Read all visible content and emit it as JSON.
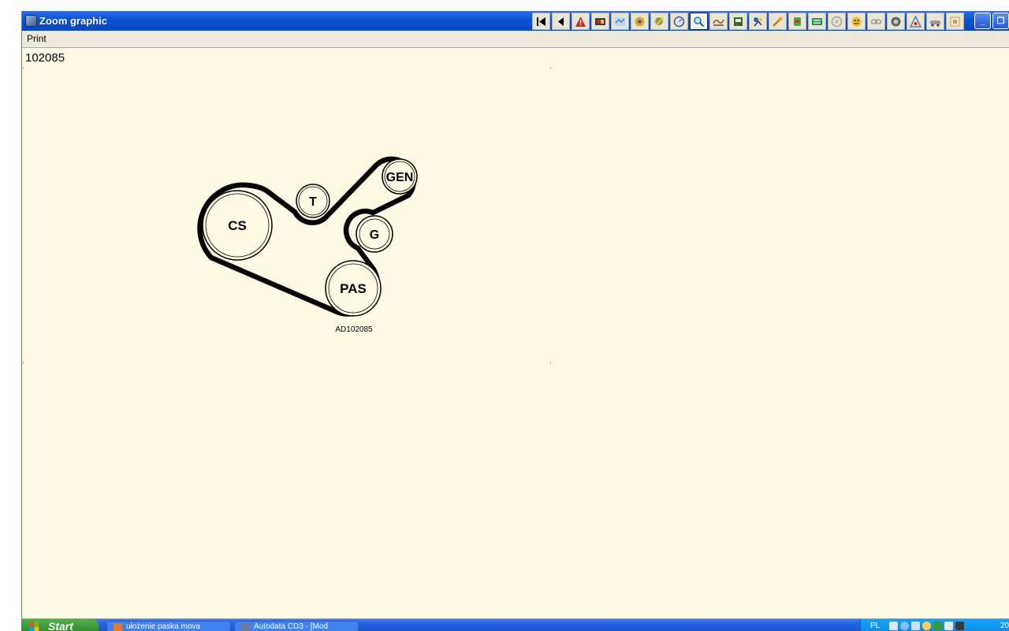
{
  "window": {
    "title": "Zoom graphic"
  },
  "toolbar": {
    "buttons": [
      {
        "name": "first-page-icon",
        "glyph": "|◀",
        "color": "#000000"
      },
      {
        "name": "previous-icon",
        "glyph": "◀",
        "color": "#000000"
      },
      {
        "name": "warning-icon",
        "glyph": "⚠",
        "color": "#d42a1a"
      },
      {
        "name": "engine-data-icon",
        "glyph": "■",
        "color": "#8a1a1a"
      },
      {
        "name": "adjustment-icon",
        "glyph": "≈",
        "color": "#3a7bd0"
      },
      {
        "name": "service-icon",
        "glyph": "⚙",
        "color": "#d08a1a"
      },
      {
        "name": "wrench-icon",
        "glyph": "✱",
        "color": "#6b8e23"
      },
      {
        "name": "gauge-icon",
        "glyph": "◎",
        "color": "#3a5a9a"
      },
      {
        "name": "zoom-graphic-icon",
        "glyph": "⌕",
        "color": "#1a7a9a"
      },
      {
        "name": "belt-icon",
        "glyph": "∿",
        "color": "#b06a1a"
      },
      {
        "name": "lift-icon",
        "glyph": "▥",
        "color": "#2a6a2a"
      },
      {
        "name": "repair-icon",
        "glyph": "✚",
        "color": "#1a5a9a"
      },
      {
        "name": "key-icon",
        "glyph": "⚷",
        "color": "#b0801a"
      },
      {
        "name": "electrical-icon",
        "glyph": "⚡",
        "color": "#c02a2a"
      },
      {
        "name": "wiring-icon",
        "glyph": "☰",
        "color": "#1a9a4a"
      },
      {
        "name": "brakes-icon",
        "glyph": "◍",
        "color": "#9a9a9a"
      },
      {
        "name": "airbag-icon",
        "glyph": "☻",
        "color": "#e0a000"
      },
      {
        "name": "chain-icon",
        "glyph": "∞",
        "color": "#9a9a9a"
      },
      {
        "name": "tyre-icon",
        "glyph": "◉",
        "color": "#5a6a5a"
      },
      {
        "name": "lamp-icon",
        "glyph": "△",
        "color": "#5a7ab0"
      },
      {
        "name": "vehicle-icon",
        "glyph": "⛟",
        "color": "#8a8a8a"
      },
      {
        "name": "settings-icon",
        "glyph": "▣",
        "color": "#c0a060"
      }
    ]
  },
  "window_controls": {
    "minimize": "_",
    "maximize": "❐"
  },
  "menu": {
    "items": [
      "Print"
    ]
  },
  "figure": {
    "number": "102085",
    "code": "AD102085",
    "pulleys": {
      "cs": "CS",
      "t": "T",
      "gen": "GEN",
      "g": "G",
      "pas": "PAS"
    }
  },
  "taskbar": {
    "start_label": "Start",
    "tasks": [
      "ułożenie paska mova",
      "Autodata CD3 - [Mod"
    ],
    "language": "PL",
    "clock": "20"
  },
  "colors": {
    "titlebar": "#0a52d6",
    "canvas": "#fdfbe3",
    "menubar": "#ece9d8",
    "taskbar": "#245edb",
    "start_button": "#3c9c37",
    "belt": "#000000"
  }
}
